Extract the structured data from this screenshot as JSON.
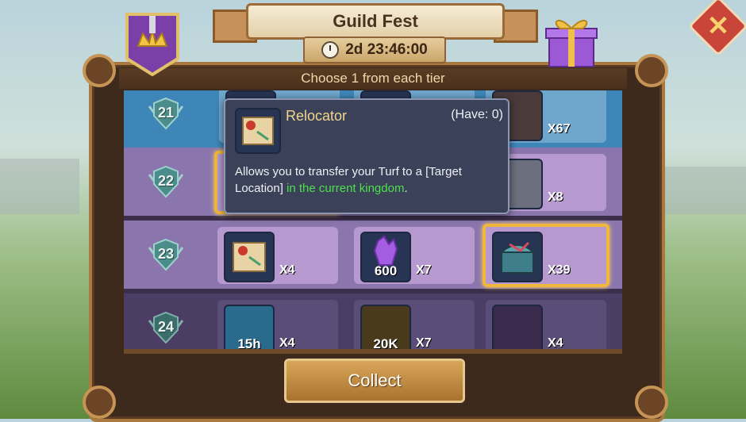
{
  "header": {
    "title": "Guild Fest",
    "timer": "2d 23:46:00",
    "subtitle": "Choose 1 from each tier"
  },
  "icons": {
    "guild": "guild-crown-shield-icon",
    "gift": "gift-box-icon",
    "close": "close-icon",
    "clock": "clock-icon",
    "tier": "winged-shield-icon"
  },
  "colors": {
    "accent_gold": "#f0b73b",
    "cell_purple": "#b599cf",
    "close_red": "#c9453a",
    "highlight_green": "#4ee04d"
  },
  "tiers": [
    {
      "number": "21",
      "items": [
        {
          "icon": "scroll-icon",
          "amount": "",
          "qty": ""
        },
        {
          "icon": "coin-icon",
          "amount": "",
          "qty": ""
        },
        {
          "icon": "armor-icon",
          "amount": "",
          "qty": "X67"
        }
      ]
    },
    {
      "number": "22",
      "items": [
        {
          "icon": "relocator-icon",
          "amount": "",
          "qty": ""
        },
        {
          "icon": "gem-icon",
          "amount": "",
          "qty": ""
        },
        {
          "icon": "crystal-icon",
          "amount": "",
          "qty": "X8"
        }
      ]
    },
    {
      "number": "23",
      "items": [
        {
          "icon": "relocator-icon",
          "amount": "",
          "qty": "X4"
        },
        {
          "icon": "purple-gem-icon",
          "amount": "600",
          "qty": "X7"
        },
        {
          "icon": "treasure-chest-icon",
          "amount": "",
          "qty": "X39"
        }
      ]
    },
    {
      "number": "24",
      "items": [
        {
          "icon": "speedup-icon",
          "amount": "15h",
          "qty": "X4"
        },
        {
          "icon": "energy-icon",
          "amount": "20K",
          "qty": "X7"
        },
        {
          "icon": "chest-icon",
          "amount": "",
          "qty": "X4"
        }
      ]
    }
  ],
  "popup": {
    "name": "Relocator",
    "have": "(Have: 0)",
    "desc_part1": "Allows you to transfer your Turf to a [Target Location] ",
    "desc_highlight": "in the current kingdom",
    "desc_part2": "."
  },
  "collect_label": "Collect"
}
